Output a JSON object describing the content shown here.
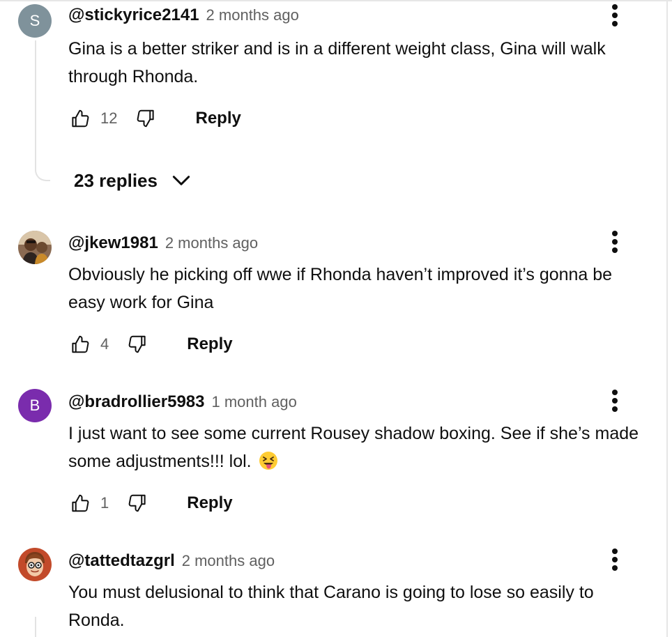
{
  "comments": [
    {
      "author": "@stickyrice2141",
      "time": "2 months ago",
      "avatar_letter": "S",
      "avatar_color": "#7f929b",
      "text": "Gina is a better striker and is in a different weight class, Gina will walk through Rhonda.",
      "likes": "12",
      "reply_label": "Reply",
      "replies_label": "23 replies"
    },
    {
      "author": "@jkew1981",
      "time": "2 months ago",
      "avatar": "photo",
      "text": "Obviously he picking off wwe if Rhonda haven’t improved it’s gonna be easy work for Gina",
      "likes": "4",
      "reply_label": "Reply"
    },
    {
      "author": "@bradrollier5983",
      "time": "1 month ago",
      "avatar_letter": "B",
      "avatar_color": "#7a2cad",
      "text": "I just want to see some current Rousey shadow boxing. See if she’s made some adjustments!!! lol.",
      "emoji": "squinting-face-with-tongue",
      "likes": "1",
      "reply_label": "Reply"
    },
    {
      "author": "@tattedtazgrl",
      "time": "2 months ago",
      "avatar": "cartoon-photo",
      "text": "You must delusional to think that Carano is going to lose so easily to Ronda."
    }
  ],
  "icons": {
    "like": "thumbs-up-icon",
    "dislike": "thumbs-down-icon",
    "menu": "more-vert-icon",
    "expand": "chevron-down-icon"
  }
}
